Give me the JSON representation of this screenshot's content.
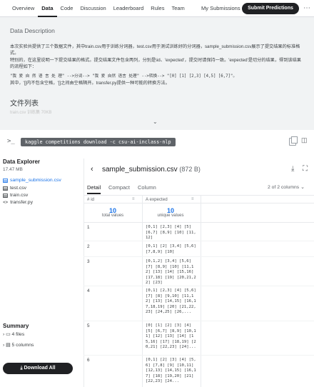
{
  "nav": {
    "tabs": [
      "Overview",
      "Data",
      "Code",
      "Discussion",
      "Leaderboard",
      "Rules",
      "Team"
    ],
    "active_tab": "Data",
    "my_submissions": "My Submissions",
    "submit": "Submit Predictions"
  },
  "description": {
    "title": "Data Description",
    "p1": "本次实验共提供了三个数据文件，其中train.csv用于训练分词器，test.csv用于测试训练好的分词器，sample_submission.csv展示了提交结果的标准格式。",
    "p2": "特别的，在这里说明一下提交结果的格式。提交结果文件包含两列，分别是\\id、'expected'，提交时请保持一致。'expected'是切分的结果，得到该结果的流程如下：",
    "code": "\"我 爱 自 然 语 言 处 理\" -->分词--> \"我 爱 自然 语言 处理\" -->转换--> \"[0] [1] [2,3] [4,5] [6,7]\"。",
    "p3": "其中，'[]内不包含空格，'[]之间由空格隔开。transfer.py提供一种可能的转换方法。",
    "files_title": "文件列表",
    "faded_text": "train.csv    训练集    70KB"
  },
  "cli": {
    "prompt": ">_",
    "command": "kaggle competitions download -c csu-ai-inclass-nlp"
  },
  "explorer": {
    "title": "Data Explorer",
    "size": "17.47 MB",
    "files": [
      {
        "name": "sample_submission.csv",
        "icon": "table-icon"
      },
      {
        "name": "test.csv",
        "icon": "table-icon"
      },
      {
        "name": "train.csv",
        "icon": "table-icon"
      },
      {
        "name": "transfer.py",
        "icon": "code-icon"
      }
    ]
  },
  "summary": {
    "title": "Summary",
    "files": "4 files",
    "columns": "5 columns"
  },
  "download_all": "Download All",
  "viewer": {
    "file_name": "sample_submission.csv",
    "file_size": "(872 B)",
    "tabs": [
      "Detail",
      "Compact",
      "Column"
    ],
    "columns_info": "2 of 2 columns",
    "col1": "id",
    "col2": "expected",
    "col1_type": "#",
    "col2_type": "A",
    "stats": {
      "count": "10",
      "count_label": "total values",
      "unique": "10",
      "unique_label": "unique values"
    },
    "rows": [
      {
        "id": "1",
        "expected": "[0,1] [2,3] [4] [5] [6,7] [8,9] [10] [11,12]"
      },
      {
        "id": "2",
        "expected": "[0,1] [2] [3,4] [5,6] [7,8,9] [10]"
      },
      {
        "id": "3",
        "expected": "[0,1,2] [3,4] [5,6] [7] [8,9] [10] [11,12] [13] [14] [15,16] [17,18] [19] [20,21,22] [23]"
      },
      {
        "id": "4",
        "expected": "[0,1] [2,3] [4] [5,6] [7] [8] [9,10] [11,12] [13] [14,15] [16,17,18,19] [20] [21,22,23] [24,25] [26,..."
      },
      {
        "id": "5",
        "expected": "[0] [1] [2] [3] [4] [5] [6,7] [8,9] [10,11] [12] [13] [14] [15,16] [17] [18,19] [20,21] [22,23] [24]..."
      },
      {
        "id": "6",
        "expected": "[0,1] [2] [3] [4] [5,6] [7,8] [9] [10,11] [12,13] [14,15] [16,17] [18] [19,20] [21] [22,23] [24..."
      }
    ]
  }
}
